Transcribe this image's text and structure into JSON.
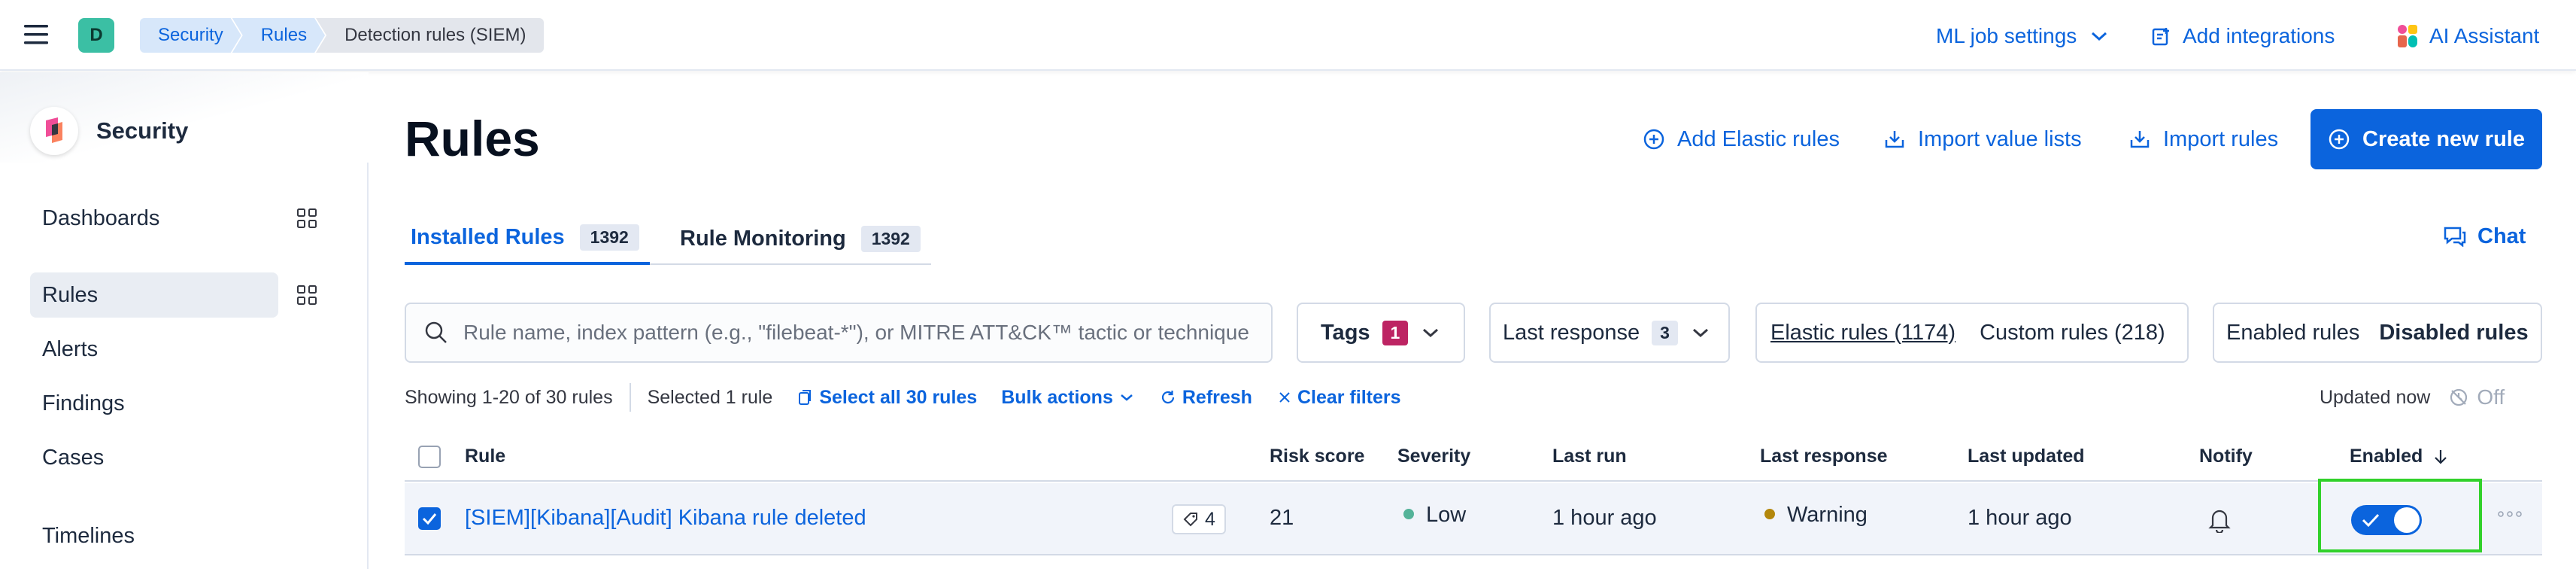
{
  "header": {
    "space_initial": "D",
    "breadcrumbs": [
      "Security",
      "Rules",
      "Detection rules (SIEM)"
    ],
    "links": {
      "ml_job_settings": "ML job settings",
      "add_integrations": "Add integrations",
      "ai_assistant": "AI Assistant"
    }
  },
  "sidebar": {
    "title": "Security",
    "items": [
      {
        "label": "Dashboards"
      },
      {
        "label": "Rules"
      },
      {
        "label": "Alerts"
      },
      {
        "label": "Findings"
      },
      {
        "label": "Cases"
      },
      {
        "label": "Timelines"
      }
    ]
  },
  "page": {
    "title": "Rules",
    "actions": {
      "add_elastic_rules": "Add Elastic rules",
      "import_value_lists": "Import value lists",
      "import_rules": "Import rules",
      "create_new_rule": "Create new rule"
    },
    "tabs": [
      {
        "label": "Installed Rules",
        "count": "1392"
      },
      {
        "label": "Rule Monitoring",
        "count": "1392"
      }
    ],
    "chat": "Chat"
  },
  "filters": {
    "search_placeholder": "Rule name, index pattern (e.g., \"filebeat-*\"), or MITRE ATT&CK™ tactic or technique",
    "tags_label": "Tags",
    "tags_count": "1",
    "last_response_label": "Last response",
    "last_response_count": "3",
    "elastic_rules": "Elastic rules (1174)",
    "custom_rules": "Custom rules (218)",
    "enabled_rules": "Enabled rules",
    "disabled_rules": "Disabled rules"
  },
  "toolbar": {
    "showing": "Showing 1-20 of 30 rules",
    "selected": "Selected 1 rule",
    "select_all": "Select all 30 rules",
    "bulk_actions": "Bulk actions",
    "refresh": "Refresh",
    "clear_filters": "Clear filters",
    "updated": "Updated now",
    "auto_refresh": "Off"
  },
  "table": {
    "columns": {
      "rule": "Rule",
      "risk_score": "Risk score",
      "severity": "Severity",
      "last_run": "Last run",
      "last_response": "Last response",
      "last_updated": "Last updated",
      "notify": "Notify",
      "enabled": "Enabled"
    },
    "rows": [
      {
        "name": "[SIEM][Kibana][Audit] Kibana rule deleted",
        "tags": "4",
        "risk_score": "21",
        "severity": "Low",
        "last_run": "1 hour ago",
        "last_response": "Warning",
        "last_updated": "1 hour ago",
        "enabled": true,
        "selected": true
      }
    ]
  },
  "colors": {
    "accent": "#0b64dd",
    "severity_low": "#54b399",
    "warning": "#b3870c",
    "tags_badge": "#bd2463",
    "highlight": "#31d12b"
  }
}
